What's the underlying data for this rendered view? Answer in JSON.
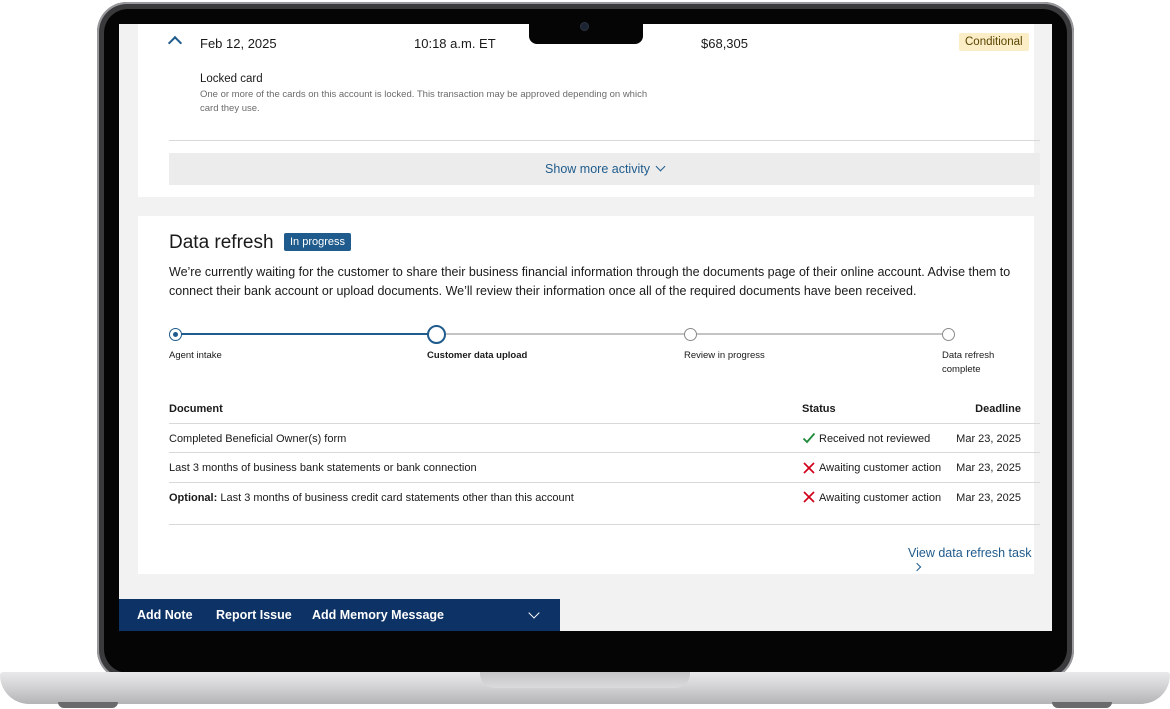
{
  "transaction": {
    "date": "Feb 12, 2025",
    "time": "10:18 a.m. ET",
    "amount": "$68,305",
    "status_badge": "Conditional",
    "note_title": "Locked card",
    "note_desc": "One or more of the cards on this account is locked. This transaction may be approved depending on which card they use.",
    "show_more_label": "Show more activity"
  },
  "data_refresh": {
    "title": "Data refresh",
    "status_badge": "In progress",
    "description": "We’re currently waiting for the customer to share their business financial information through the documents page of their online account. Advise them to connect their bank account or upload documents. We’ll review their information once all of the required documents have been received.",
    "steps": [
      {
        "label": "Agent intake",
        "state": "done"
      },
      {
        "label": "Customer data upload",
        "state": "current"
      },
      {
        "label": "Review in progress",
        "state": "upcoming"
      },
      {
        "label": "Data refresh complete",
        "state": "upcoming"
      }
    ],
    "table": {
      "headers": {
        "document": "Document",
        "status": "Status",
        "deadline": "Deadline"
      },
      "rows": [
        {
          "prefix": "",
          "document": "Completed Beneficial Owner(s) form",
          "status_icon": "check-icon",
          "status": "Received not reviewed",
          "deadline": "Mar 23, 2025"
        },
        {
          "prefix": "",
          "document": "Last 3 months of business bank statements or bank connection",
          "status_icon": "x-icon",
          "status": "Awaiting customer action",
          "deadline": "Mar 23, 2025"
        },
        {
          "prefix": "Optional:",
          "document": "Last 3 months of business credit card statements other than this account",
          "status_icon": "x-icon",
          "status": "Awaiting customer action",
          "deadline": "Mar 23, 2025"
        }
      ]
    },
    "view_task_label": "View data refresh task"
  },
  "bottom_bar": {
    "add_note": "Add Note",
    "report_issue": "Report Issue",
    "add_memory": "Add Memory Message"
  },
  "colors": {
    "accent": "#1f5b8c",
    "bottom_bar": "#0c3266",
    "conditional_badge": "#fbedc6",
    "success": "#1f8a3a",
    "error": "#d0021b"
  }
}
